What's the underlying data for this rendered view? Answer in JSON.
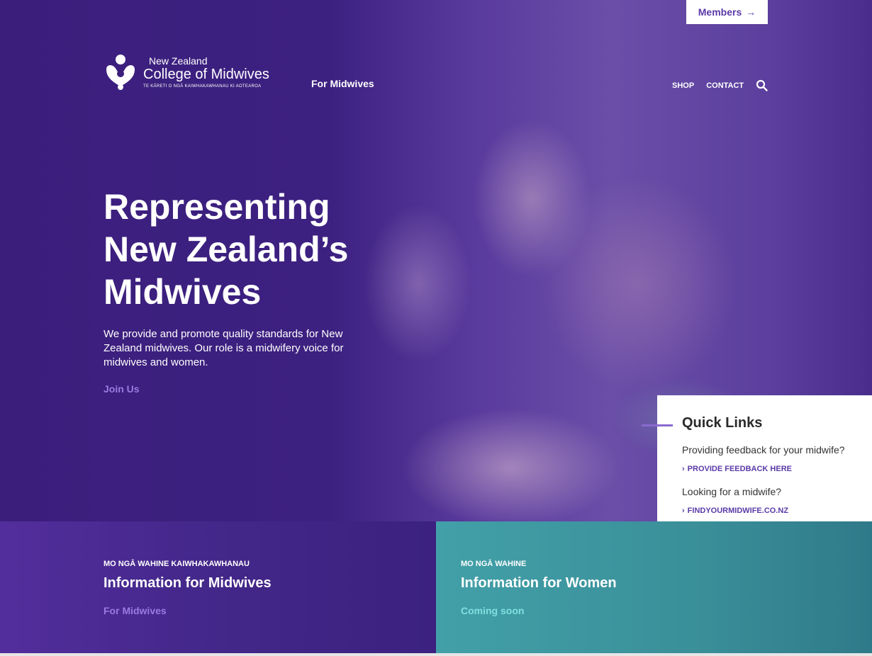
{
  "header": {
    "members_label": "Members",
    "logo": {
      "line1": "New Zealand",
      "line2": "College of Midwives",
      "line3": "TE KĀRETI O NGĀ KAIWHAKAWHANAU KI AOTEAROA"
    },
    "nav": {
      "for_midwives": "For Midwives",
      "shop": "SHOP",
      "contact": "CONTACT"
    }
  },
  "hero": {
    "title_line1": "Representing",
    "title_line2": "New Zealand’s",
    "title_line3": "Midwives",
    "description": "We provide and promote quality standards for New Zealand midwives. Our role is a midwifery voice for midwives and women.",
    "join_label": "Join Us"
  },
  "quick_links": {
    "title": "Quick Links",
    "items": [
      {
        "question": "Providing feedback for your midwife?",
        "link": "PROVIDE FEEDBACK HERE"
      },
      {
        "question": "Looking for a midwife?",
        "link": "FINDYOURMIDWIFE.CO.NZ"
      }
    ]
  },
  "panels": {
    "midwives": {
      "kicker": "MO NGĀ WAHINE KAIWHAKAWHANAU",
      "heading": "Information for Midwives",
      "link": "For Midwives"
    },
    "women": {
      "kicker": "MO NGĀ WAHINE",
      "heading": "Information for Women",
      "link": "Coming soon"
    }
  },
  "colors": {
    "brand_purple": "#3b1e7c",
    "accent_purple": "#9b7be0",
    "teal": "#42a0a8",
    "teal_link": "#7fe0e0"
  }
}
